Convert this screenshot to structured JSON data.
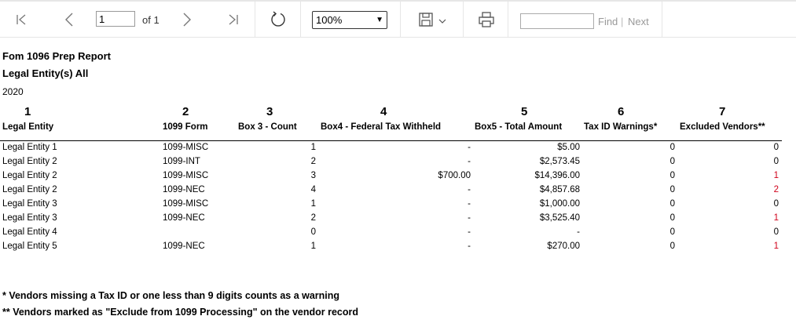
{
  "toolbar": {
    "page_value": "1",
    "of_label": "of 1",
    "zoom_value": "100%",
    "find_value": "",
    "find_label": "Find",
    "separator": "|",
    "next_label": "Next"
  },
  "report": {
    "title": "Fom 1096 Prep Report",
    "subtitle": "Legal Entity(s) All",
    "year": "2020"
  },
  "columns": [
    {
      "num": "1",
      "header": "Legal Entity"
    },
    {
      "num": "2",
      "header": "1099 Form"
    },
    {
      "num": "3",
      "header": "Box 3 - Count"
    },
    {
      "num": "4",
      "header": "Box4 - Federal Tax Withheld"
    },
    {
      "num": "5",
      "header": "Box5 - Total Amount"
    },
    {
      "num": "6",
      "header": "Tax ID Warnings*"
    },
    {
      "num": "7",
      "header": "Excluded Vendors**"
    }
  ],
  "rows": [
    {
      "entity": "Legal Entity 1",
      "form": "1099-MISC",
      "count": "1",
      "fed": "-",
      "total": "$5.00",
      "warn": "0",
      "excl": "0"
    },
    {
      "entity": "Legal Entity 2",
      "form": "1099-INT",
      "count": "2",
      "fed": "-",
      "total": "$2,573.45",
      "warn": "0",
      "excl": "0"
    },
    {
      "entity": "Legal Entity 2",
      "form": "1099-MISC",
      "count": "3",
      "fed": "$700.00",
      "total": "$14,396.00",
      "warn": "0",
      "excl": "1"
    },
    {
      "entity": "Legal Entity 2",
      "form": "1099-NEC",
      "count": "4",
      "fed": "-",
      "total": "$4,857.68",
      "warn": "0",
      "excl": "2"
    },
    {
      "entity": "Legal Entity 3",
      "form": "1099-MISC",
      "count": "1",
      "fed": "-",
      "total": "$1,000.00",
      "warn": "0",
      "excl": "0"
    },
    {
      "entity": "Legal Entity 3",
      "form": "1099-NEC",
      "count": "2",
      "fed": "-",
      "total": "$3,525.40",
      "warn": "0",
      "excl": "1"
    },
    {
      "entity": "Legal Entity 4",
      "form": "",
      "count": "0",
      "fed": "-",
      "total": "-",
      "warn": "0",
      "excl": "0"
    },
    {
      "entity": "Legal Entity 5",
      "form": "1099-NEC",
      "count": "1",
      "fed": "-",
      "total": "$270.00",
      "warn": "0",
      "excl": "1"
    }
  ],
  "colors": {
    "excluded_nonzero": "#d0021b"
  },
  "footnotes": [
    "* Vendors missing a Tax ID or one less than 9 digits counts as a warning",
    "** Vendors marked as \"Exclude from 1099 Processing\" on the vendor record"
  ]
}
